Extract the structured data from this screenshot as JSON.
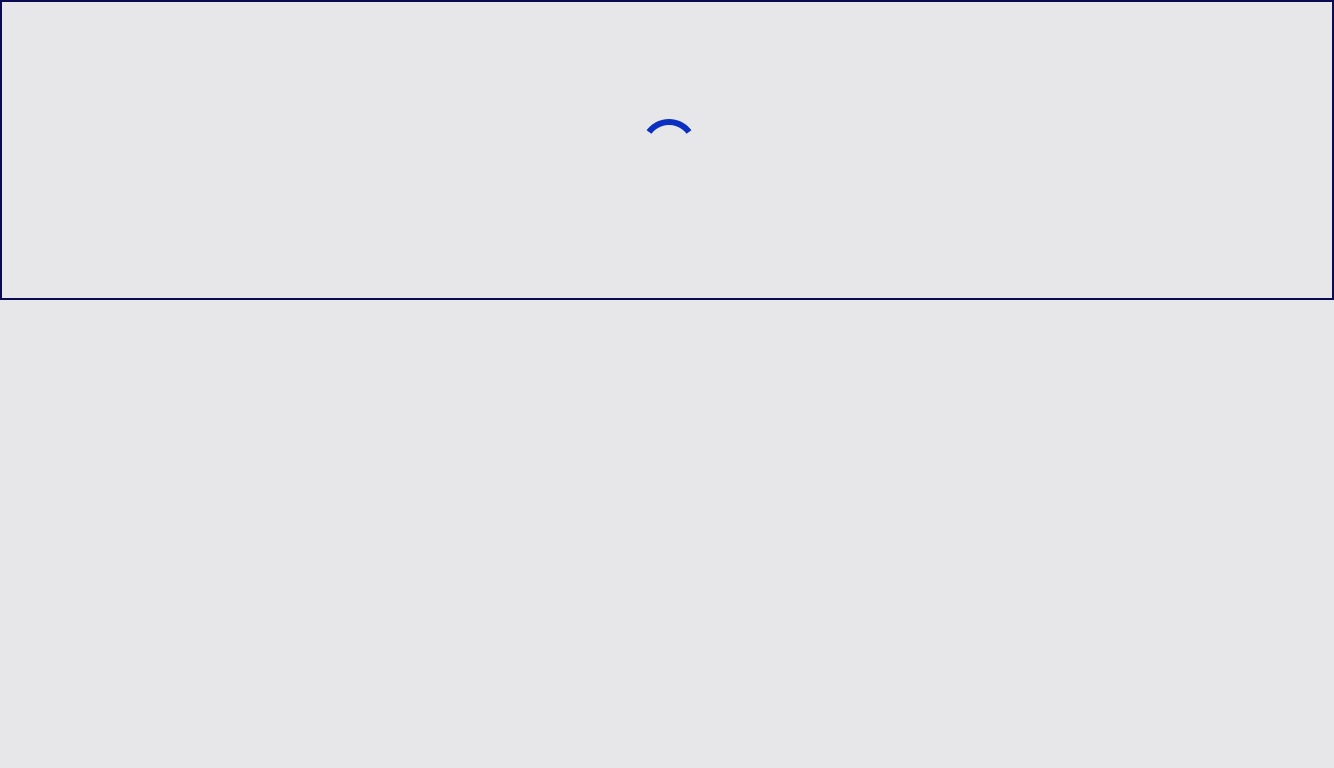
{
  "loading_panel": {
    "spinner_icon": "loading-spinner-icon",
    "colors": {
      "background": "#e7e7ea",
      "border": "#0b0b52",
      "spinner": "#0b2fc0"
    }
  }
}
